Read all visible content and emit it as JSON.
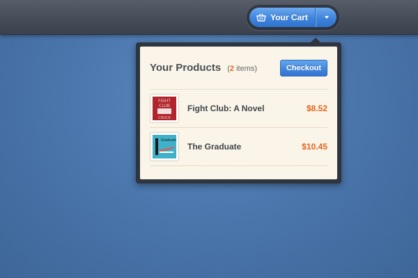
{
  "header": {
    "cart_label": "Your Cart",
    "basket_icon": "basket-icon",
    "dropdown_icon": "caret-down-icon"
  },
  "popover": {
    "title": "Your Products",
    "item_count": "2",
    "item_suffix": "items",
    "checkout_label": "Checkout"
  },
  "products": [
    {
      "name": "Fight Club: A Novel",
      "price": "$8.52",
      "cover_text": [
        "FIGHT",
        "CLUB",
        "CHUCK"
      ]
    },
    {
      "name": "The Graduate",
      "price": "$10.45",
      "cover_text": [
        "Graduate"
      ]
    }
  ],
  "colors": {
    "accent": "#3f84dc",
    "price": "#e2641d",
    "panel": "#fbf6ea",
    "background": "#4a76ad"
  }
}
